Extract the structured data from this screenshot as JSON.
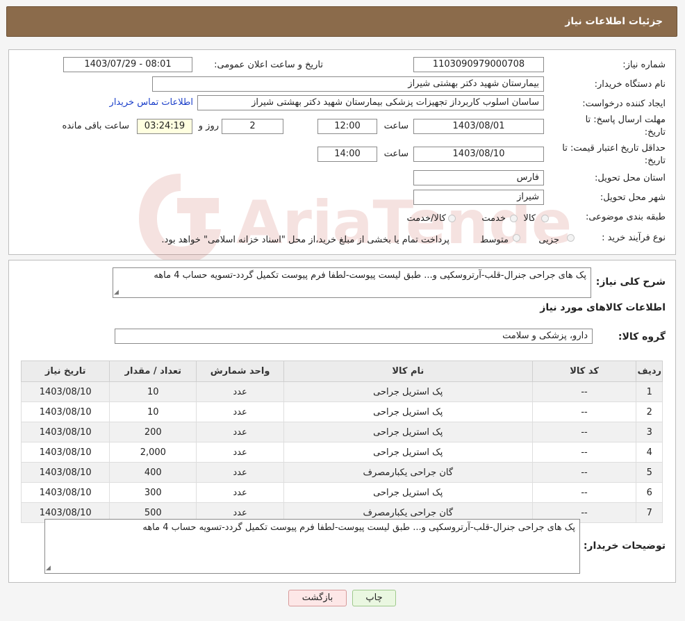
{
  "header": {
    "title": "جزئیات اطلاعات نیاز"
  },
  "fields": {
    "need_number_label": "شماره نیاز:",
    "need_number": "1103090979000708",
    "announce_label": "تاریخ و ساعت اعلان عمومی:",
    "announce_value": "1403/07/29 - 08:01",
    "buyer_org_label": "نام دستگاه خریدار:",
    "buyer_org": "بیمارستان شهید دکتر بهشتی شیراز",
    "requester_label": "ایجاد کننده درخواست:",
    "requester": "ساسان اسلوب کاربرداز  تجهیزات پزشکی بیمارستان شهید دکتر بهشتی شیراز",
    "contact_link": "اطلاعات تماس خریدار",
    "deadline_label_1": "مهلت ارسال پاسخ: تا",
    "deadline_label_2": "تاریخ:",
    "deadline_date": "1403/08/01",
    "time_label": "ساعت",
    "deadline_time": "12:00",
    "days_value": "2",
    "days_label": "روز و",
    "remaining_time": "03:24:19",
    "remaining_label": "ساعت باقی مانده",
    "validity_label_1": "حداقل تاریخ اعتبار قیمت: تا",
    "validity_label_2": "تاریخ:",
    "validity_date": "1403/08/10",
    "validity_time": "14:00",
    "province_label": "استان محل تحویل:",
    "province": "فارس",
    "city_label": "شهر محل تحویل:",
    "city": "شیراز",
    "category_label": "طبقه بندی موضوعی:",
    "category_options": [
      "کالا",
      "خدمت",
      "کالا/خدمت"
    ],
    "process_label": "نوع فرآیند خرید :",
    "process_options": [
      "جزیی",
      "متوسط"
    ],
    "process_note": "پرداخت تمام یا بخشی از مبلغ خرید،از محل \"اسناد خزانه اسلامی\" خواهد بود."
  },
  "summary": {
    "label": "شرح کلی نیاز:",
    "text": "پک های جراحی جنرال-قلب-آرتروسکپی و... طبق لیست پیوست-لطفا فرم پیوست تکمیل گردد-تسویه حساب 4 ماهه"
  },
  "goods": {
    "section_title": "اطلاعات کالاهای مورد نیاز",
    "group_label": "گروه کالا:",
    "group_value": "دارو، پزشکی و سلامت"
  },
  "table": {
    "headers": [
      "ردیف",
      "کد کالا",
      "نام کالا",
      "واحد شمارش",
      "تعداد / مقدار",
      "تاریخ نیاز"
    ],
    "rows": [
      [
        "1",
        "--",
        "پک استریل جراحی",
        "عدد",
        "10",
        "1403/08/10"
      ],
      [
        "2",
        "--",
        "پک استریل جراحی",
        "عدد",
        "10",
        "1403/08/10"
      ],
      [
        "3",
        "--",
        "پک استریل جراحی",
        "عدد",
        "200",
        "1403/08/10"
      ],
      [
        "4",
        "--",
        "پک استریل جراحی",
        "عدد",
        "2,000",
        "1403/08/10"
      ],
      [
        "5",
        "--",
        "گان جراحی یکبارمصرف",
        "عدد",
        "400",
        "1403/08/10"
      ],
      [
        "6",
        "--",
        "پک استریل جراحی",
        "عدد",
        "300",
        "1403/08/10"
      ],
      [
        "7",
        "--",
        "گان جراحی یکبارمصرف",
        "عدد",
        "500",
        "1403/08/10"
      ]
    ]
  },
  "buyer_notes": {
    "label": "توضیحات خریدار:",
    "text": "پک های جراحی جنرال-قلب-آرتروسکپی و... طبق لیست پیوست-لطفا فرم پیوست تکمیل گردد-تسویه حساب 4 ماهه"
  },
  "buttons": {
    "print": "چاپ",
    "back": "بازگشت"
  },
  "watermark": {
    "text": "AriaTender.neT"
  },
  "colors": {
    "header_bg": "#8b6b4b",
    "link": "#1a3ec9",
    "watermark": "#c0392b"
  }
}
